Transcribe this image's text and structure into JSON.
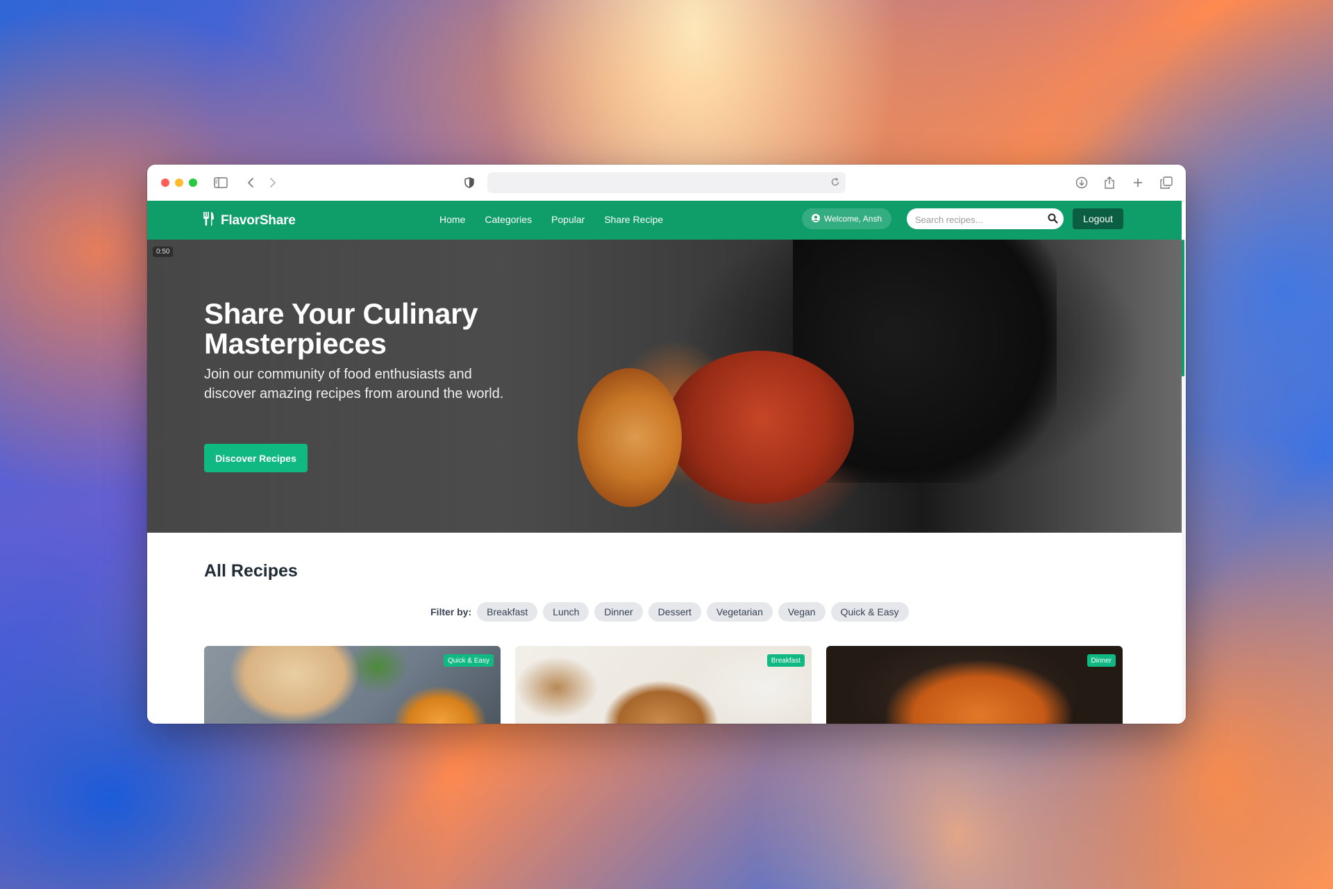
{
  "browser": {
    "url": "",
    "icons": [
      "sidebar-icon",
      "back-icon",
      "forward-icon",
      "shield-icon",
      "reload-icon",
      "download-icon",
      "share-icon",
      "new-tab-icon",
      "tabs-icon"
    ]
  },
  "site": {
    "brand": "FlavorShare",
    "brand_icon": "utensils-icon",
    "nav": [
      "Home",
      "Categories",
      "Popular",
      "Share Recipe"
    ],
    "welcome": "Welcome, Ansh",
    "search_placeholder": "Search recipes...",
    "logout": "Logout",
    "colors": {
      "primary": "#0f9e6a",
      "accent": "#10b981",
      "dark": "#0b5e41"
    }
  },
  "hero": {
    "video_time": "0:50",
    "title": "Share Your Culinary Masterpieces",
    "subtitle": "Join our community of food enthusiasts and discover amazing recipes from around the world.",
    "cta": "Discover Recipes"
  },
  "recipes": {
    "heading": "All Recipes",
    "filter_label": "Filter by:",
    "filters": [
      "Breakfast",
      "Lunch",
      "Dinner",
      "Dessert",
      "Vegetarian",
      "Vegan",
      "Quick & Easy"
    ],
    "cards": [
      {
        "badge": "Quick & Easy"
      },
      {
        "badge": "Breakfast"
      },
      {
        "badge": "Dinner"
      }
    ]
  }
}
